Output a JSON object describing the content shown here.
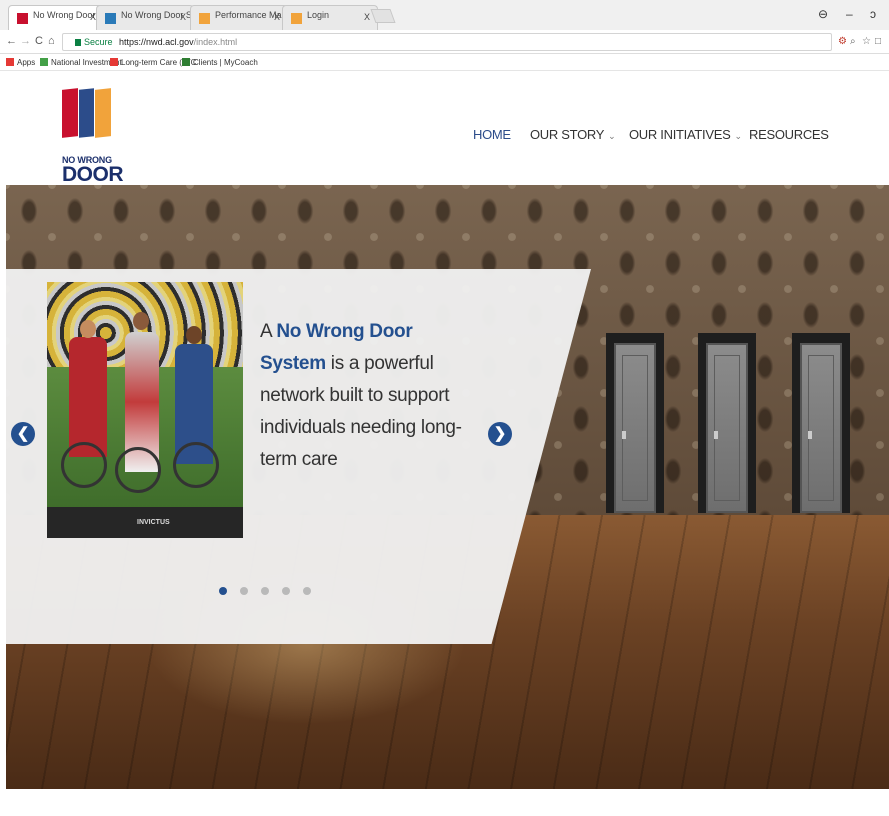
{
  "browser": {
    "tabs": [
      {
        "label": "No Wrong Door",
        "close": "X",
        "favicon_color": "#c8102e",
        "active": true
      },
      {
        "label": "No Wrong Door Syster",
        "close": "X",
        "favicon_color": "#2a7ab8",
        "active": false
      },
      {
        "label": "Performance Manager",
        "close": "X",
        "favicon_color": "#f1a33b",
        "active": false
      },
      {
        "label": "Login",
        "close": "X",
        "favicon_color": "#f1a33b",
        "active": false
      }
    ],
    "window_controls": {
      "profile": "⊖",
      "minimize": "–",
      "restore": "ɔ"
    },
    "address": {
      "back": "←",
      "forward": "→",
      "reload": "C",
      "home": "⌂",
      "secure_label": "Secure",
      "url_host": "https://nwd.acl.gov",
      "url_path": "/index.html"
    },
    "extensions": [
      "⚙",
      "⌕",
      "☆",
      "□"
    ],
    "bookmarks": [
      {
        "label": "Apps",
        "icon_color": "#e53935"
      },
      {
        "label": "National Investment",
        "icon_color": "#43a047"
      },
      {
        "label": "Long-term Care (LTC",
        "icon_color": "#e53935"
      },
      {
        "label": "Clients | MyCoach",
        "icon_color": "#2e7d32"
      }
    ]
  },
  "site": {
    "logo": {
      "line1": "NO WRONG",
      "line2": "DOOR",
      "colors": [
        "#c8102e",
        "#2c4c8a",
        "#f1a33b"
      ]
    },
    "nav": [
      {
        "label": "HOME",
        "has_dropdown": false,
        "active": true
      },
      {
        "label": "OUR STORY",
        "has_dropdown": true,
        "active": false
      },
      {
        "label": "OUR INITIATIVES",
        "has_dropdown": true,
        "active": false
      },
      {
        "label": "RESOURCES",
        "has_dropdown": false,
        "active": false
      }
    ],
    "dropdown_glyph": "⌄",
    "hero": {
      "text_prefix": "A ",
      "text_highlight": "No Wrong Door System",
      "text_suffix": " is a powerful network built to support individuals needing long-term care",
      "photo_caption": "INVICTUS",
      "prev_arrow": "❮",
      "next_arrow": "❯",
      "slide_count": 5,
      "active_slide": 1
    },
    "colors": {
      "brand_blue": "#24508f",
      "nav_active": "#2c4c8a"
    }
  }
}
